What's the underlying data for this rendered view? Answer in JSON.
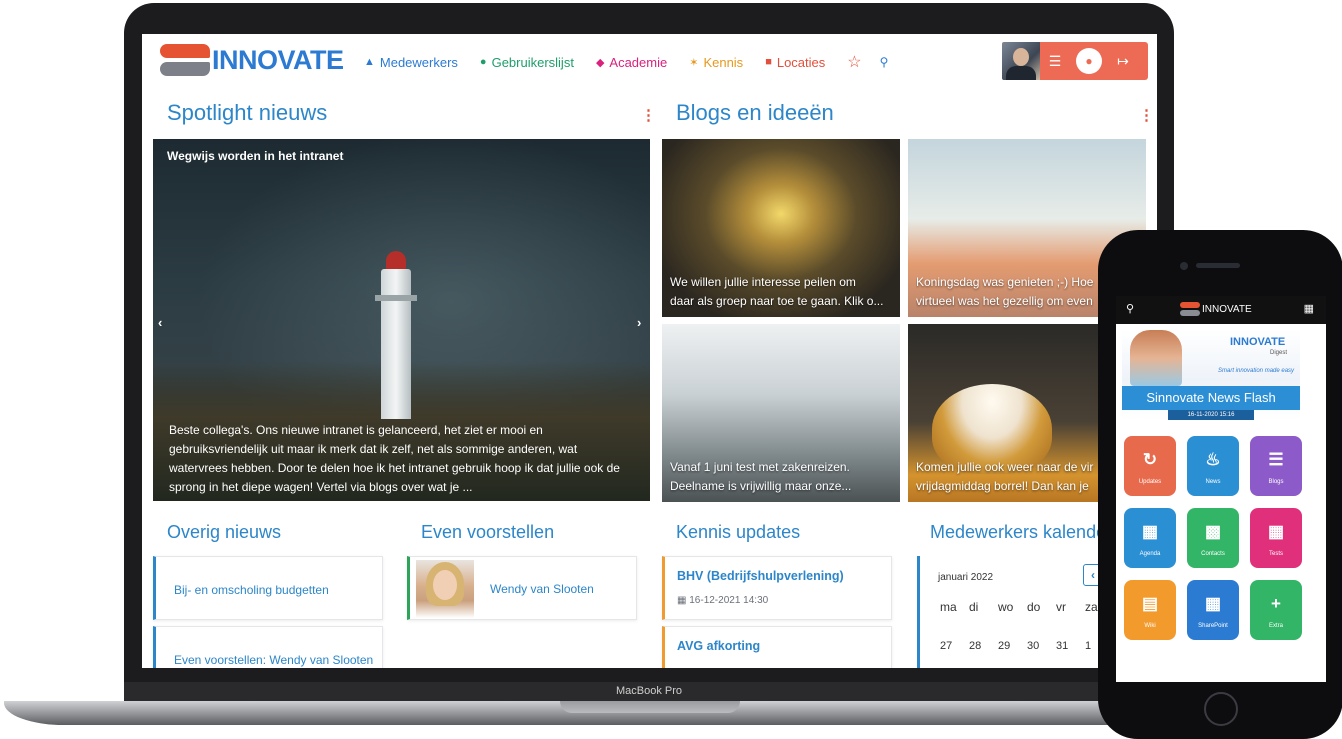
{
  "brand": {
    "name": "INNOVATE"
  },
  "nav": {
    "employees": "Medewerkers",
    "users": "Gebruikerslijst",
    "academy": "Academie",
    "knowledge": "Kennis",
    "locations": "Locaties"
  },
  "sections": {
    "spotlight": "Spotlight nieuws",
    "blogs": "Blogs en ideeën",
    "other_news": "Overig nieuws",
    "introductions": "Even voorstellen",
    "knowledge_updates": "Kennis updates",
    "calendar": "Medewerkers kalender"
  },
  "spotlight": {
    "title": "Wegwijs worden in het intranet",
    "text": "Beste collega's. Ons nieuwe intranet is gelanceerd, het ziet er mooi en gebruiksvriendelijk uit maar ik merk dat ik zelf, net als sommige anderen, wat watervrees hebben. Door te delen hoe ik het intranet gebruik hoop ik dat jullie ook de sprong in het diepe wagen! Vertel via blogs over wat je ..."
  },
  "blogs": [
    {
      "line1": "We willen jullie interesse peilen om",
      "line2": "daar als groep naar toe te gaan. Klik o..."
    },
    {
      "line1": "Koningsdag was genieten ;-) Hoe",
      "line2": "virtueel was het gezellig om even"
    },
    {
      "line1": "Vanaf 1 juni test met zakenreizen.",
      "line2": "Deelname is vrijwillig maar onze..."
    },
    {
      "line1": "Komen jullie ook weer naar de vir",
      "line2": "vrijdagmiddag borrel! Dan kan je"
    }
  ],
  "other_news": [
    "Bij- en omscholing budgetten",
    "Even voorstellen: Wendy van Slooten"
  ],
  "introductions": [
    {
      "name": "Wendy van Slooten"
    }
  ],
  "knowledge_updates": [
    {
      "title": "BHV (Bedrijfshulpverlening)",
      "date": "16-12-2021 14:30"
    },
    {
      "title": "AVG afkorting",
      "date": ""
    }
  ],
  "calendar": {
    "month": "januari 2022",
    "days": [
      "ma",
      "di",
      "wo",
      "do",
      "vr",
      "za"
    ],
    "first_row": [
      "27",
      "28",
      "29",
      "30",
      "31",
      "1"
    ]
  },
  "laptop_label": "MacBook Pro",
  "phone": {
    "brand": "INNOVATE",
    "banner_brand": "INNOVATE",
    "banner_sub": "Digest",
    "banner_tagline": "Smart innovation made easy",
    "banner_title": "Sinnovate News Flash",
    "banner_date": "16-11-2020 15:16",
    "apps": [
      "Updates",
      "News",
      "Blogs",
      "Agenda",
      "Contacts",
      "Tests",
      "Wiki",
      "SharePoint",
      "Extra"
    ]
  },
  "colors": {
    "brand_blue": "#2c7ad2",
    "brand_orange": "#e55332",
    "user_bar": "#ed6a55"
  }
}
